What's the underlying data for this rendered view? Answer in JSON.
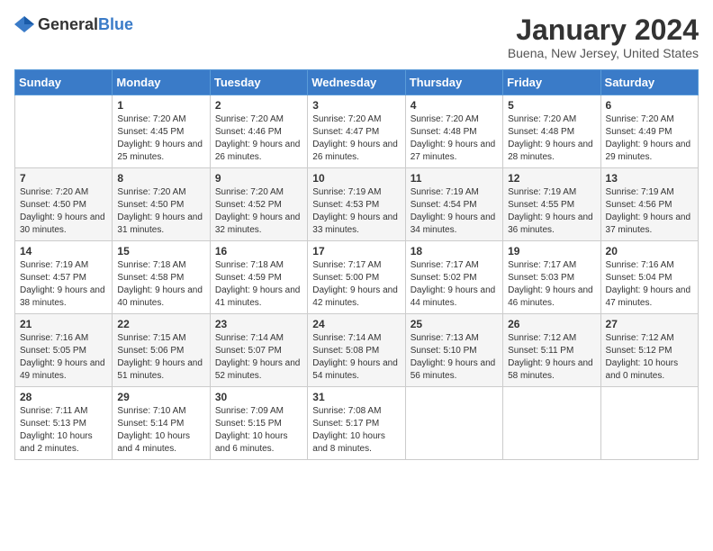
{
  "logo": {
    "general": "General",
    "blue": "Blue"
  },
  "header": {
    "month": "January 2024",
    "location": "Buena, New Jersey, United States"
  },
  "weekdays": [
    "Sunday",
    "Monday",
    "Tuesday",
    "Wednesday",
    "Thursday",
    "Friday",
    "Saturday"
  ],
  "weeks": [
    [
      {
        "day": "",
        "sunrise": "",
        "sunset": "",
        "daylight": ""
      },
      {
        "day": "1",
        "sunrise": "Sunrise: 7:20 AM",
        "sunset": "Sunset: 4:45 PM",
        "daylight": "Daylight: 9 hours and 25 minutes."
      },
      {
        "day": "2",
        "sunrise": "Sunrise: 7:20 AM",
        "sunset": "Sunset: 4:46 PM",
        "daylight": "Daylight: 9 hours and 26 minutes."
      },
      {
        "day": "3",
        "sunrise": "Sunrise: 7:20 AM",
        "sunset": "Sunset: 4:47 PM",
        "daylight": "Daylight: 9 hours and 26 minutes."
      },
      {
        "day": "4",
        "sunrise": "Sunrise: 7:20 AM",
        "sunset": "Sunset: 4:48 PM",
        "daylight": "Daylight: 9 hours and 27 minutes."
      },
      {
        "day": "5",
        "sunrise": "Sunrise: 7:20 AM",
        "sunset": "Sunset: 4:48 PM",
        "daylight": "Daylight: 9 hours and 28 minutes."
      },
      {
        "day": "6",
        "sunrise": "Sunrise: 7:20 AM",
        "sunset": "Sunset: 4:49 PM",
        "daylight": "Daylight: 9 hours and 29 minutes."
      }
    ],
    [
      {
        "day": "7",
        "sunrise": "",
        "sunset": "",
        "daylight": ""
      },
      {
        "day": "8",
        "sunrise": "Sunrise: 7:20 AM",
        "sunset": "Sunset: 4:50 PM",
        "daylight": "Daylight: 9 hours and 31 minutes."
      },
      {
        "day": "9",
        "sunrise": "Sunrise: 7:20 AM",
        "sunset": "Sunset: 4:52 PM",
        "daylight": "Daylight: 9 hours and 32 minutes."
      },
      {
        "day": "10",
        "sunrise": "Sunrise: 7:19 AM",
        "sunset": "Sunset: 4:53 PM",
        "daylight": "Daylight: 9 hours and 33 minutes."
      },
      {
        "day": "11",
        "sunrise": "Sunrise: 7:19 AM",
        "sunset": "Sunset: 4:54 PM",
        "daylight": "Daylight: 9 hours and 34 minutes."
      },
      {
        "day": "12",
        "sunrise": "Sunrise: 7:19 AM",
        "sunset": "Sunset: 4:55 PM",
        "daylight": "Daylight: 9 hours and 36 minutes."
      },
      {
        "day": "13",
        "sunrise": "Sunrise: 7:19 AM",
        "sunset": "Sunset: 4:56 PM",
        "daylight": "Daylight: 9 hours and 37 minutes."
      }
    ],
    [
      {
        "day": "14",
        "sunrise": "",
        "sunset": "",
        "daylight": ""
      },
      {
        "day": "15",
        "sunrise": "Sunrise: 7:18 AM",
        "sunset": "Sunset: 4:58 PM",
        "daylight": "Daylight: 9 hours and 40 minutes."
      },
      {
        "day": "16",
        "sunrise": "Sunrise: 7:18 AM",
        "sunset": "Sunset: 4:59 PM",
        "daylight": "Daylight: 9 hours and 41 minutes."
      },
      {
        "day": "17",
        "sunrise": "Sunrise: 7:17 AM",
        "sunset": "Sunset: 5:00 PM",
        "daylight": "Daylight: 9 hours and 42 minutes."
      },
      {
        "day": "18",
        "sunrise": "Sunrise: 7:17 AM",
        "sunset": "Sunset: 5:02 PM",
        "daylight": "Daylight: 9 hours and 44 minutes."
      },
      {
        "day": "19",
        "sunrise": "Sunrise: 7:17 AM",
        "sunset": "Sunset: 5:03 PM",
        "daylight": "Daylight: 9 hours and 46 minutes."
      },
      {
        "day": "20",
        "sunrise": "Sunrise: 7:16 AM",
        "sunset": "Sunset: 5:04 PM",
        "daylight": "Daylight: 9 hours and 47 minutes."
      }
    ],
    [
      {
        "day": "21",
        "sunrise": "",
        "sunset": "",
        "daylight": ""
      },
      {
        "day": "22",
        "sunrise": "Sunrise: 7:15 AM",
        "sunset": "Sunset: 5:06 PM",
        "daylight": "Daylight: 9 hours and 51 minutes."
      },
      {
        "day": "23",
        "sunrise": "Sunrise: 7:14 AM",
        "sunset": "Sunset: 5:07 PM",
        "daylight": "Daylight: 9 hours and 52 minutes."
      },
      {
        "day": "24",
        "sunrise": "Sunrise: 7:14 AM",
        "sunset": "Sunset: 5:08 PM",
        "daylight": "Daylight: 9 hours and 54 minutes."
      },
      {
        "day": "25",
        "sunrise": "Sunrise: 7:13 AM",
        "sunset": "Sunset: 5:10 PM",
        "daylight": "Daylight: 9 hours and 56 minutes."
      },
      {
        "day": "26",
        "sunrise": "Sunrise: 7:12 AM",
        "sunset": "Sunset: 5:11 PM",
        "daylight": "Daylight: 9 hours and 58 minutes."
      },
      {
        "day": "27",
        "sunrise": "Sunrise: 7:12 AM",
        "sunset": "Sunset: 5:12 PM",
        "daylight": "Daylight: 10 hours and 0 minutes."
      }
    ],
    [
      {
        "day": "28",
        "sunrise": "",
        "sunset": "",
        "daylight": ""
      },
      {
        "day": "29",
        "sunrise": "Sunrise: 7:10 AM",
        "sunset": "Sunset: 5:14 PM",
        "daylight": "Daylight: 10 hours and 4 minutes."
      },
      {
        "day": "30",
        "sunrise": "Sunrise: 7:09 AM",
        "sunset": "Sunset: 5:15 PM",
        "daylight": "Daylight: 10 hours and 6 minutes."
      },
      {
        "day": "31",
        "sunrise": "Sunrise: 7:08 AM",
        "sunset": "Sunset: 5:17 PM",
        "daylight": "Daylight: 10 hours and 8 minutes."
      },
      {
        "day": "",
        "sunrise": "",
        "sunset": "",
        "daylight": ""
      },
      {
        "day": "",
        "sunrise": "",
        "sunset": "",
        "daylight": ""
      },
      {
        "day": "",
        "sunrise": "",
        "sunset": "",
        "daylight": ""
      }
    ]
  ],
  "week1_sunday": {
    "sunrise": "Sunrise: 7:20 AM",
    "sunset": "Sunset: 4:50 PM",
    "daylight": "Daylight: 9 hours and 30 minutes."
  },
  "week2_sunday": {
    "sunrise": "Sunrise: 7:19 AM",
    "sunset": "Sunset: 4:57 PM",
    "daylight": "Daylight: 9 hours and 38 minutes."
  },
  "week3_sunday": {
    "sunrise": "Sunrise: 7:16 AM",
    "sunset": "Sunset: 5:05 PM",
    "daylight": "Daylight: 9 hours and 49 minutes."
  },
  "week4_sunday": {
    "sunrise": "Sunrise: 7:11 AM",
    "sunset": "Sunset: 5:13 PM",
    "daylight": "Daylight: 10 hours and 2 minutes."
  }
}
